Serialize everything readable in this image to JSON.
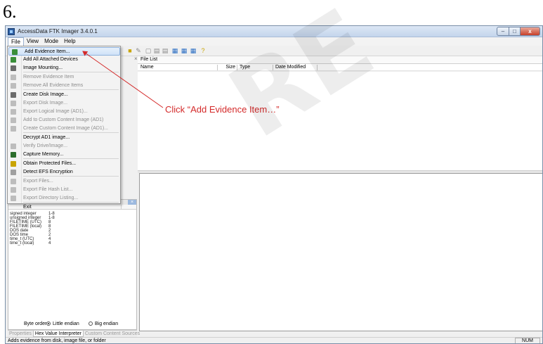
{
  "step_number": "6.",
  "window": {
    "title": "AccessData FTK Imager 3.4.0.1",
    "buttons": {
      "minimize": "–",
      "maximize": "□",
      "close": "x"
    }
  },
  "menubar": [
    "File",
    "View",
    "Mode",
    "Help"
  ],
  "file_menu": {
    "items": [
      {
        "label": "Add Evidence Item...",
        "enabled": true,
        "highlighted": true,
        "icon": "add-evidence-icon",
        "color": "#3a8f3a"
      },
      {
        "label": "Add All Attached Devices",
        "enabled": true,
        "icon": "attached-devices-icon",
        "color": "#3a8f3a"
      },
      {
        "label": "Image Mounting...",
        "enabled": true,
        "icon": "image-mounting-icon",
        "color": "#6b6b6b"
      },
      {
        "label": "Remove Evidence Item",
        "enabled": false,
        "icon": "remove-evidence-icon",
        "color": "#bdbdbd"
      },
      {
        "label": "Remove All Evidence Items",
        "enabled": false,
        "icon": "remove-all-icon",
        "color": "#bdbdbd"
      },
      {
        "label": "Create Disk Image...",
        "enabled": true,
        "icon": "create-disk-image-icon",
        "color": "#6b6b6b"
      },
      {
        "label": "Export Disk Image...",
        "enabled": false,
        "icon": "export-disk-image-icon",
        "color": "#bdbdbd"
      },
      {
        "label": "Export Logical Image (AD1)...",
        "enabled": false,
        "icon": "export-logical-image-icon",
        "color": "#bdbdbd"
      },
      {
        "label": "Add to Custom Content Image (AD1)",
        "enabled": false,
        "icon": "custom-content-add-icon",
        "color": "#bdbdbd"
      },
      {
        "label": "Create Custom Content Image (AD1)...",
        "enabled": false,
        "icon": "custom-content-create-icon",
        "color": "#bdbdbd"
      },
      {
        "label": "Decrypt AD1 image...",
        "enabled": true,
        "icon": "",
        "color": ""
      },
      {
        "label": "Verify Drive/Image...",
        "enabled": false,
        "icon": "verify-drive-icon",
        "color": "#bdbdbd"
      },
      {
        "label": "Capture Memory...",
        "enabled": true,
        "icon": "capture-memory-icon",
        "color": "#2c6e2c"
      },
      {
        "label": "Obtain Protected Files...",
        "enabled": true,
        "icon": "obtain-protected-icon",
        "color": "#c9a400"
      },
      {
        "label": "Detect EFS Encryption",
        "enabled": true,
        "icon": "detect-efs-icon",
        "color": "#a0a0a0"
      },
      {
        "label": "Export Files...",
        "enabled": false,
        "icon": "export-files-icon",
        "color": "#bdbdbd"
      },
      {
        "label": "Export File Hash List...",
        "enabled": false,
        "icon": "export-hash-icon",
        "color": "#bdbdbd"
      },
      {
        "label": "Export Directory Listing...",
        "enabled": false,
        "icon": "export-directory-icon",
        "color": "#bdbdbd"
      },
      {
        "label": "Exit",
        "enabled": true,
        "icon": "",
        "color": ""
      }
    ]
  },
  "file_list": {
    "title": "File List",
    "columns": [
      "Name",
      "Size",
      "Type",
      "Date Modified"
    ]
  },
  "hex_interpreter": {
    "rows": [
      {
        "type": "signed integer",
        "size": "1-8"
      },
      {
        "type": "unsigned integer",
        "size": "1-8"
      },
      {
        "type": "FILETIME (UTC)",
        "size": "8"
      },
      {
        "type": "FILETIME (local)",
        "size": "8"
      },
      {
        "type": "DOS date",
        "size": "2"
      },
      {
        "type": "DOS time",
        "size": "2"
      },
      {
        "type": "time_t (UTC)",
        "size": "4"
      },
      {
        "type": "time_t (local)",
        "size": "4"
      }
    ],
    "byte_order_label": "Byte order:",
    "little_endian": "Little endian",
    "big_endian": "Big endian"
  },
  "bottom_tabs": [
    "Properties",
    "Hex Value Interpreter",
    "Custom Content Sources"
  ],
  "status": {
    "text": "Adds evidence from disk, image file, or folder",
    "num": "NUM"
  },
  "annotation": {
    "text": "Click “Add Evidence Item…”",
    "color": "#d42a2a"
  },
  "watermark": "RE"
}
